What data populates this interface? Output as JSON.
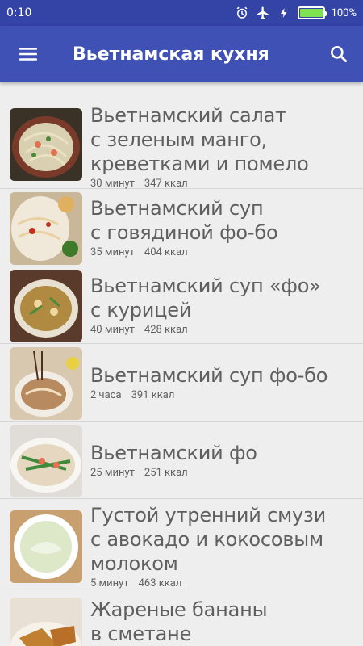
{
  "status": {
    "time": "0:10",
    "battery_text": "100%",
    "battery_level": 1.0,
    "icons": [
      "alarm-icon",
      "airplane-icon",
      "charging-icon",
      "battery-icon"
    ]
  },
  "appbar": {
    "title": "Вьетнамская кухня",
    "menu_icon": "hamburger-menu-icon",
    "search_icon": "search-icon",
    "color": "#3f51b5"
  },
  "recipes": [
    {
      "title_lines": [
        "Вьетнамский салат",
        "с зеленым манго,",
        "креветками и помело"
      ],
      "time": "30 минут",
      "kcal": "347 ккал"
    },
    {
      "title_lines": [
        "Вьетнамский суп",
        "с говядиной фо-бо"
      ],
      "time": "35 минут",
      "kcal": "404 ккал"
    },
    {
      "title_lines": [
        "Вьетнамский суп «фо»",
        "с курицей"
      ],
      "time": "40 минут",
      "kcal": "428 ккал"
    },
    {
      "title_lines": [
        "Вьетнамский суп фо-бо"
      ],
      "time": "2 часа",
      "kcal": "391 ккал"
    },
    {
      "title_lines": [
        "Вьетнамский фо"
      ],
      "time": "25 минут",
      "kcal": "251 ккал"
    },
    {
      "title_lines": [
        "Густой утренний смузи",
        "с авокадо и кокосовым",
        "молоком"
      ],
      "time": "5 минут",
      "kcal": "463 ккал"
    },
    {
      "title_lines": [
        "Жареные бананы",
        "в сметане"
      ],
      "time": "",
      "kcal": ""
    }
  ]
}
